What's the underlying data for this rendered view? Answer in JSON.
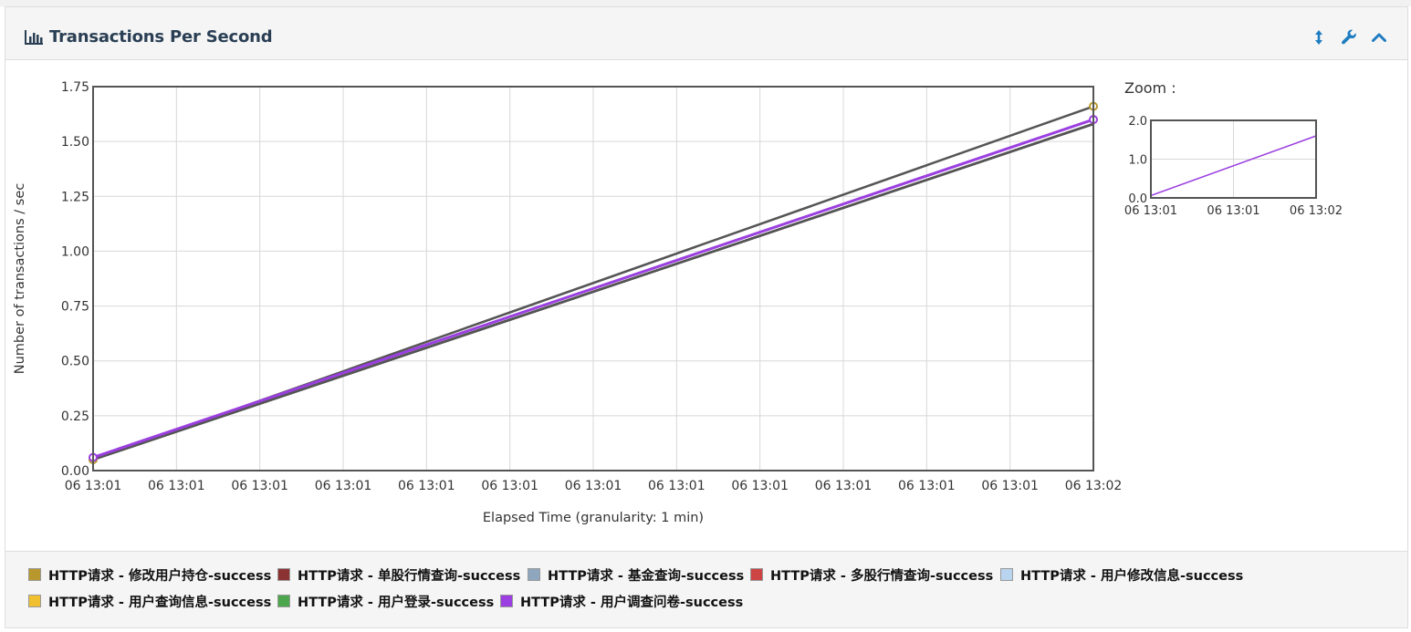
{
  "panel": {
    "title": "Transactions Per Second",
    "tools": [
      {
        "name": "resize-icon",
        "label": "↕"
      },
      {
        "name": "wrench-icon",
        "label": "wrench"
      },
      {
        "name": "collapse-icon",
        "label": "^"
      }
    ]
  },
  "colors": {
    "heading_bg": "#f5f5f5",
    "title": "#2a3f54",
    "tool_blue": "#1f7cc1",
    "grid": "#d8d8d8",
    "frame": "#545454"
  },
  "chart_data": {
    "type": "line",
    "xlabel": "Elapsed Time (granularity: 1 min)",
    "ylabel": "Number of transactions / sec",
    "x_tick_labels": [
      "06 13:01",
      "06 13:01",
      "06 13:01",
      "06 13:01",
      "06 13:01",
      "06 13:01",
      "06 13:01",
      "06 13:01",
      "06 13:01",
      "06 13:01",
      "06 13:01",
      "06 13:01",
      "06 13:02"
    ],
    "y_ticks": [
      "0.00",
      "0.25",
      "0.50",
      "0.75",
      "1.00",
      "1.25",
      "1.50",
      "1.75"
    ],
    "ylim": [
      0,
      1.75
    ],
    "x": [
      0,
      1
    ],
    "series": [
      {
        "name": "HTTP请求 - 修改用户持仓-success",
        "color": "#b8982c",
        "values": [
          0.05,
          1.66
        ]
      },
      {
        "name": "HTTP请求 - 单股行情查询-success",
        "color": "#8b3333",
        "values": [
          0.05,
          1.58
        ]
      },
      {
        "name": "HTTP请求 - 基金查询-success",
        "color": "#8fa6bf",
        "values": [
          0.05,
          1.58
        ]
      },
      {
        "name": "HTTP请求 - 多股行情查询-success",
        "color": "#cc4444",
        "values": [
          0.05,
          1.58
        ]
      },
      {
        "name": "HTTP请求 - 用户修改信息-success",
        "color": "#b8d4ef",
        "values": [
          0.05,
          1.58
        ]
      },
      {
        "name": "HTTP请求 - 用户查询信息-success",
        "color": "#f0c030",
        "values": [
          0.05,
          1.58
        ]
      },
      {
        "name": "HTTP请求 - 用户登录-success",
        "color": "#4ca64c",
        "values": [
          0.05,
          1.58
        ]
      },
      {
        "name": "HTTP请求 - 用户调查问卷-success",
        "color": "#9b3fe0",
        "values": [
          0.06,
          1.6
        ]
      }
    ],
    "grid": true,
    "legend_position": "bottom",
    "zoom": {
      "label": "Zoom :",
      "y_ticks": [
        "0.0",
        "1.0",
        "2.0"
      ],
      "ylim": [
        0,
        2
      ],
      "x_tick_labels": [
        "06 13:01",
        "06 13:01",
        "06 13:02"
      ]
    }
  }
}
